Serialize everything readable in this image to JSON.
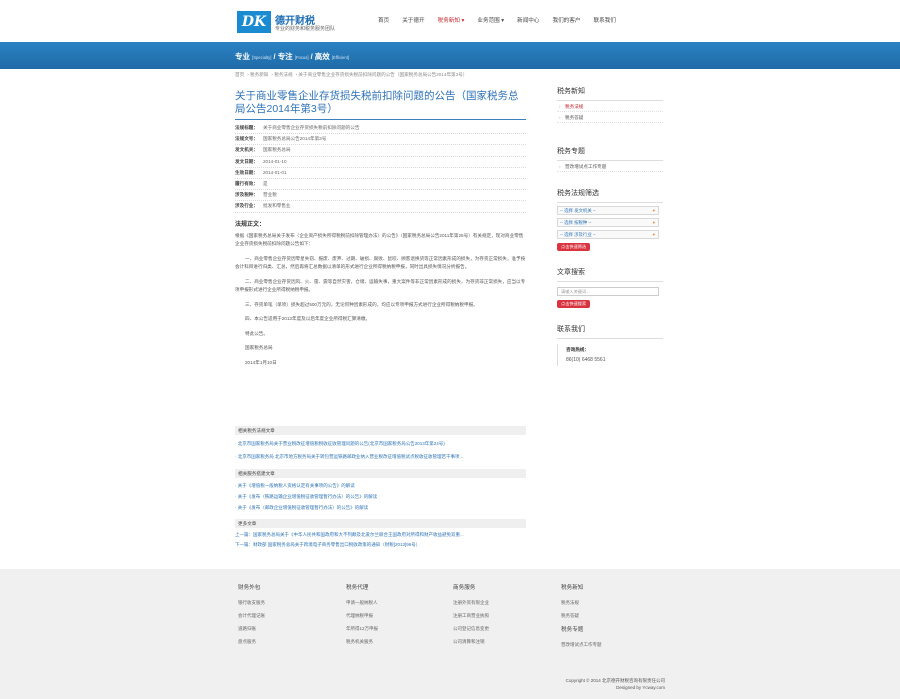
{
  "header": {
    "logo_mark": "DK",
    "logo_name": "德开财税",
    "logo_sub": "专业的财务和税务服务团队",
    "nav": [
      {
        "label": "首页"
      },
      {
        "label": "关于德开"
      },
      {
        "label": "税务新知 ▾"
      },
      {
        "label": "业务范围 ▾"
      },
      {
        "label": "新闻中心"
      },
      {
        "label": "我们的客户"
      },
      {
        "label": "联系我们"
      }
    ]
  },
  "banner": {
    "w1": "专业",
    "e1": "[Specialty]",
    "w2": "专注",
    "e2": "[Focus]",
    "w3": "高效",
    "e3": "[Efficient]"
  },
  "breadcrumb": [
    "首页",
    "税务新知",
    "税务法规",
    "关于商业零售企业存货损失税前扣除问题的公告（国家税务总局公告2014年第3号）"
  ],
  "article": {
    "title": "关于商业零售企业存货损失税前扣除问题的公告（国家税务总局公告2014年第3号）",
    "meta": [
      {
        "k": "法规标题：",
        "v": "关于商业零售企业存货损失税前扣除问题的公告"
      },
      {
        "k": "法规文号：",
        "v": "国家税务总局公告2014年第3号"
      },
      {
        "k": "发文机关：",
        "v": "国家税务总局"
      },
      {
        "k": "发文日期：",
        "v": "2014-01-10"
      },
      {
        "k": "生效日期：",
        "v": "2014-01-01"
      },
      {
        "k": "履行有效：",
        "v": "是"
      },
      {
        "k": "涉及税种：",
        "v": "营业税"
      },
      {
        "k": "涉及行业：",
        "v": "批发和零售业"
      }
    ],
    "body_head": "法规正文：",
    "p1": "根据《国家税务总局关于发布〈企业资产损失所得税税前扣除管理办法〉的公告》（国家税务总局公告2011年第25号）有关规定，现对商业零售企业存货损失税前扣除问题公告如下：",
    "p2": "一、商业零售企业存货因零星失窃、报废、废弃、过期、破损、腐败、鼠咬、顾客退换货等正常因素形成的损失，为存货正常损失，准予按会计科目进行归类、汇总，然后再将汇总数据以清单的形式进行企业所得税纳税申报，同时出具损失情况分析报告。",
    "p3": "二、商业零售企业存货因风、火、雷、震等自然灾害，仓储、运输失事，重大案件等非正常因素形成的损失，为存货非正常损失，应当以专项申报形式进行企业所得税纳税申报。",
    "p4": "三、存货单笔（单项）损失超过500万元的，无论何种因素形成的，均应以专项申报方式进行企业所得税纳税申报。",
    "p5": "四、本公告适用于2013年度及以后年度企业所得税汇算清缴。",
    "p6": "特此公告。",
    "p7": "国家税务总局",
    "p8": "2014年1月10日"
  },
  "related": {
    "head1": "相关税务法规文章",
    "items1": [
      "· 北京市国家税务局关于营业税改征增值税税收征收管理问题的公告(北京市国家税务局公告2013年第24号)",
      "· 北京市国家税务局 北京市地方税务局关于转包营运铁路邮政业纳入营业税改征增值税试点税收征收管理若干事项..."
    ],
    "head2": "相关服务搭建文章",
    "items2": [
      "· 关于《增值税一般纳税人资格认定有关事项的公告》的解读",
      "· 关于《发布〈铁路运输企业增值税征收管理暂行办法〉的公告》的解读",
      "· 关于《发布〈邮政企业增值税征收管理暂行办法〉的公告》的解读"
    ],
    "head3": "更多文章",
    "prev": "上一篇：国家税务总局关于《中华人民共和国政府和大不列颠及北爱尔兰联合王国政府对所得和财产收益避免双重...",
    "next": "下一篇：财政部 国家税务总局关于跨境电子商务零售出口税收政策的通知（财税[2013]96号）"
  },
  "sidebar": {
    "t1": "税务新知",
    "s1": [
      {
        "label": "税务法规"
      },
      {
        "label": "税务答疑"
      }
    ],
    "t2": "税务专题",
    "s2": [
      {
        "label": "营改增试点工作专题"
      }
    ],
    "t3": "税务法规筛选",
    "selects": [
      "-- 选择 发文机关 --",
      "-- 选择 按税种 --",
      "-- 选择 涉及行业 --"
    ],
    "btn1": "点击快速筛选",
    "t4": "文章搜索",
    "search_placeholder": "请输入关键词...",
    "btn2": "点击快速搜索",
    "t5": "联系我们",
    "contact_label": "咨询热线：",
    "phone": "86(10) 6468 5561"
  },
  "footer": {
    "cols": [
      {
        "title": "财务外包",
        "items": [
          "银行收支服务",
          "会计代理记账",
          "道路归账",
          "盘点服务"
        ]
      },
      {
        "title": "税务代理",
        "items": [
          "申请一般纳税人",
          "代理纳税申报",
          "年所得12万申报",
          "税务机关服务"
        ]
      },
      {
        "title": "商务服务",
        "items": [
          "注册外资有限企业",
          "注册工商营业执照",
          "公司登记信息变更",
          "公司清算和注销"
        ]
      },
      {
        "title": "税务新知",
        "items": [
          "税务法规",
          "税务答疑"
        ],
        "title2": "税务专题",
        "items2": [
          "营改增试点工作专题"
        ]
      }
    ],
    "copyright": "Copyright © 2014 北京德开财税咨询有限责任公司",
    "designed": "Designed by Ycway.com"
  }
}
